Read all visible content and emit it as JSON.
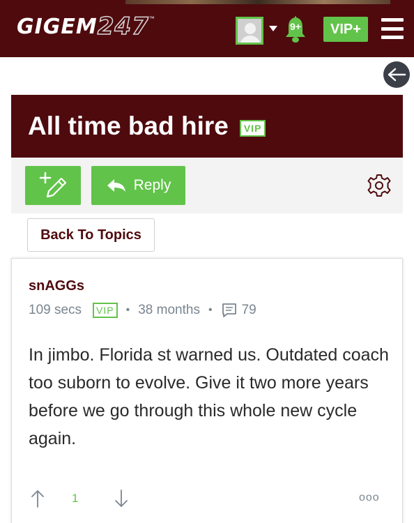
{
  "header": {
    "logo_text": "GIGEM",
    "logo_number": "247",
    "logo_tm": "™",
    "notification_count": "9+",
    "vip_plus_label": "VIP+"
  },
  "thread": {
    "title": "All time bad hire",
    "vip_badge": "VIP"
  },
  "toolbar": {
    "reply_label": "Reply"
  },
  "nav": {
    "back_to_topics_label": "Back To Topics"
  },
  "post": {
    "author": "snAGGs",
    "time_ago": "109 secs",
    "vip_badge": "VIP",
    "member_since": "38 months",
    "post_count": "79",
    "body": "In jimbo. Florida st warned us. Outdated coach too suborn to evolve. Give it two more years before we go through this whole new cycle again.",
    "vote_score": "1",
    "more_label": "ooo"
  },
  "colors": {
    "brand_maroon": "#4f0a0e",
    "accent_green": "#62c34a",
    "meta_gray": "#7a8590"
  },
  "icons": {
    "avatar": "avatar-icon",
    "dropdown": "chevron-down-icon",
    "notifications": "bell-icon",
    "menu": "hamburger-icon",
    "back": "arrow-left-icon",
    "new_post": "pencil-plus-icon",
    "reply": "reply-icon",
    "settings": "gear-icon",
    "comments": "comment-icon",
    "upvote": "arrow-up-icon",
    "downvote": "arrow-down-icon"
  }
}
